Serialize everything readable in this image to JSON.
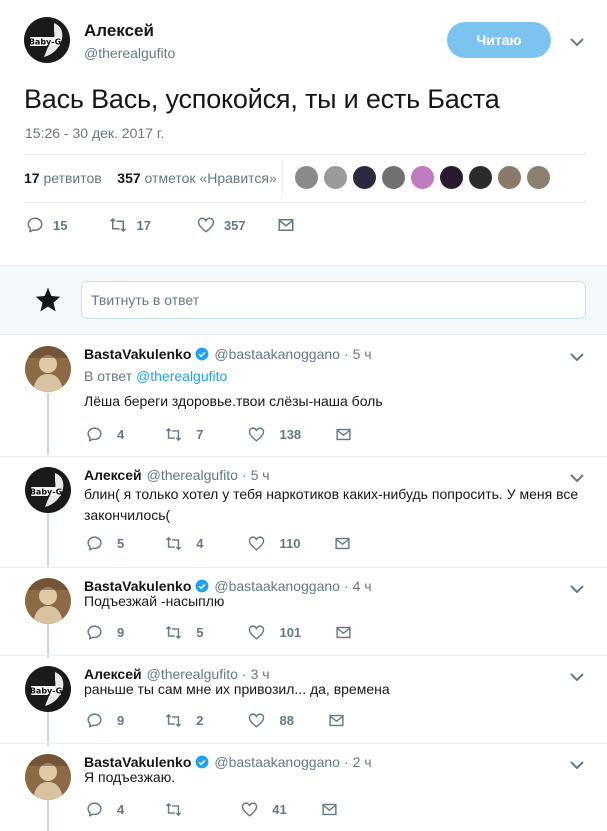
{
  "main_tweet": {
    "name": "Алексей",
    "handle": "@therealgufito",
    "follow_label": "Читаю",
    "text": "Вась Вась, успокойся, ты и есть Баста",
    "timestamp": "15:26 - 30 дек. 2017 г.",
    "retweets_count": "17",
    "retweets_label": "ретвитов",
    "likes_count": "357",
    "likes_label": "отметок «Нравится»",
    "actions": {
      "replies": "15",
      "retweets": "17",
      "likes": "357"
    },
    "liker_colors": [
      "#8a8a8a",
      "#9a9a9a",
      "#2b2b3f",
      "#707070",
      "#c07ac0",
      "#2a1a30",
      "#2b2b2b",
      "#8a7a6a",
      "#8a8070"
    ]
  },
  "reply_box": {
    "placeholder": "Твитнуть в ответ"
  },
  "replies": [
    {
      "name": "BastaVakulenko",
      "verified": true,
      "handle": "@bastaakanoggano",
      "dot": "·",
      "time": "5 ч",
      "in_reply_prefix": "В ответ",
      "in_reply_to": "@therealgufito",
      "text": "Лёша береги здоровье.твои слёзы-наша боль",
      "replies": "4",
      "retweets": "7",
      "likes": "138"
    },
    {
      "name": "Алексей",
      "verified": false,
      "handle": "@therealgufito",
      "dot": "·",
      "time": "5 ч",
      "text": "блин( я только хотел у тебя наркотиков каких-нибудь попросить. У меня все закончилось(",
      "replies": "5",
      "retweets": "4",
      "likes": "110"
    },
    {
      "name": "BastaVakulenko",
      "verified": true,
      "handle": "@bastaakanoggano",
      "dot": "·",
      "time": "4 ч",
      "text": "Подъезжай -насыплю",
      "replies": "9",
      "retweets": "5",
      "likes": "101"
    },
    {
      "name": "Алексей",
      "verified": false,
      "handle": "@therealgufito",
      "dot": "·",
      "time": "3 ч",
      "text": "раньше ты сам мне их привозил... да, времена",
      "replies": "9",
      "retweets": "2",
      "likes": "88"
    },
    {
      "name": "BastaVakulenko",
      "verified": true,
      "handle": "@bastaakanoggano",
      "dot": "·",
      "time": "2 ч",
      "text": "Я подъезжаю.",
      "replies": "4",
      "retweets": "",
      "likes": "41"
    }
  ],
  "colors": {
    "accent": "#1da1f2",
    "follow_button": "#7dc3ef",
    "muted": "#657786",
    "verified": "#1da1f2"
  }
}
